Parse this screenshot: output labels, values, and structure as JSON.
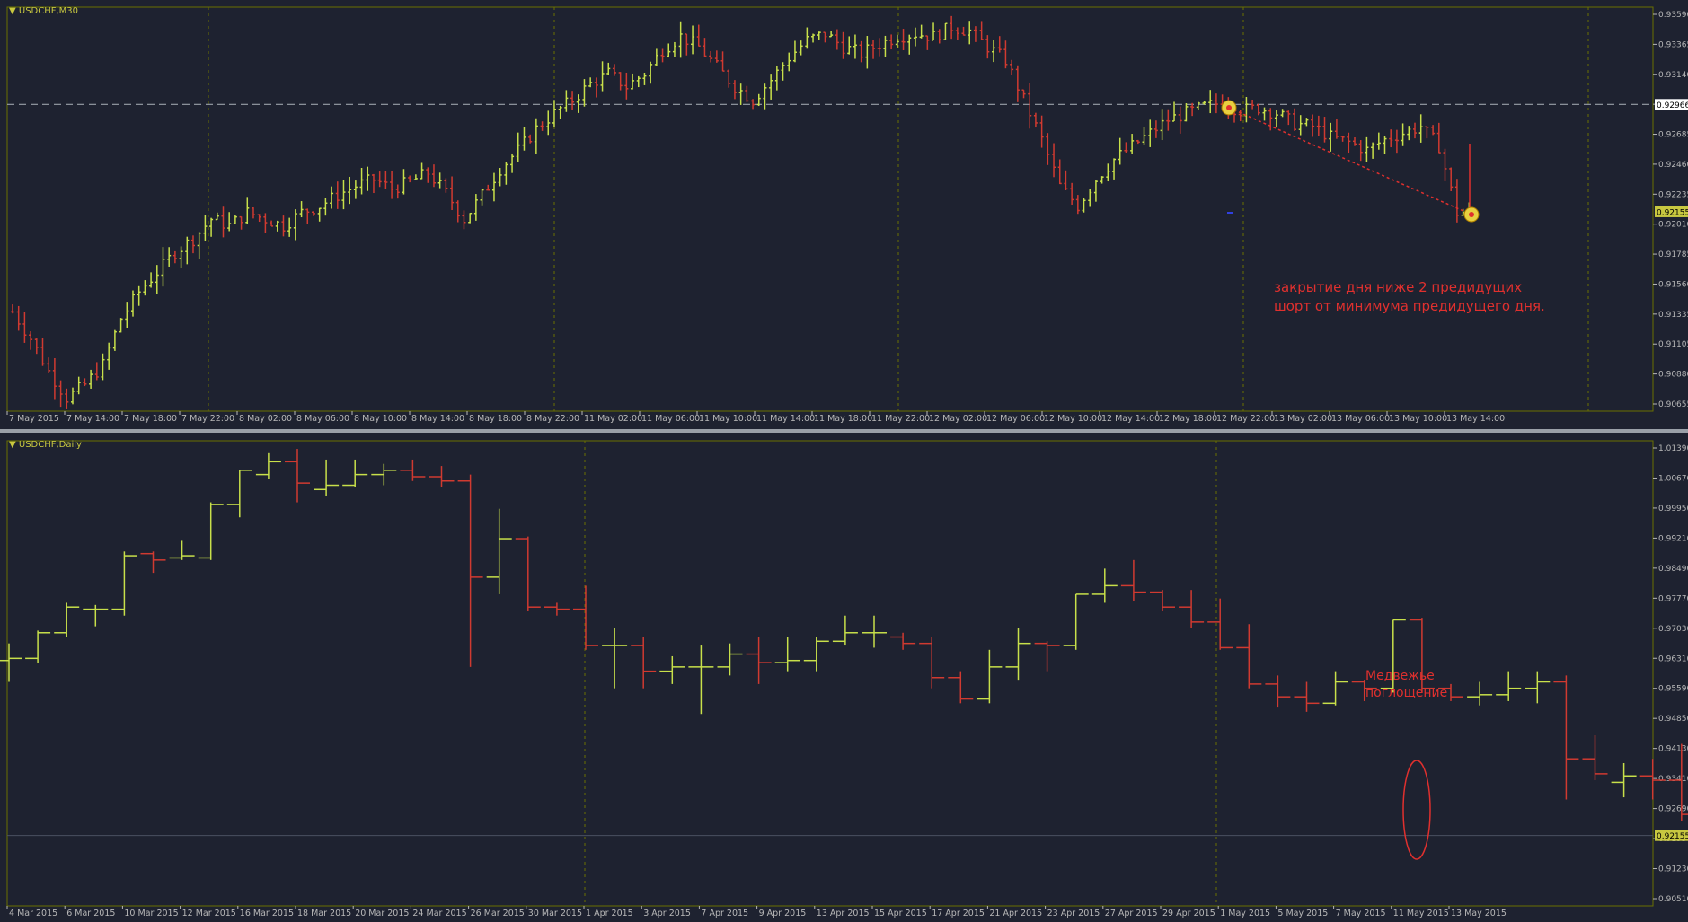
{
  "colors": {
    "bg": "#1e2230",
    "up": "#c8e04a",
    "down": "#d03a30",
    "grid": "#3a4050",
    "frame": "#6a7000",
    "text": "#b8b8b8",
    "dash": "#9aa0a8"
  },
  "chart_data": [
    {
      "type": "bar",
      "title": "USDCHF,M30",
      "ylim": [
        0.9065,
        0.937
      ],
      "y_ticks": [
        "0.93590",
        "0.93365",
        "0.93140",
        "0.92910",
        "0.92685",
        "0.92460",
        "0.92235",
        "0.92010",
        "0.91785",
        "0.91560",
        "0.91335",
        "0.91105",
        "0.90880",
        "0.90655"
      ],
      "x_ticks": [
        "7 May 2015",
        "7 May 14:00",
        "7 May 18:00",
        "7 May 22:00",
        "8 May 02:00",
        "8 May 06:00",
        "8 May 10:00",
        "8 May 14:00",
        "8 May 18:00",
        "8 May 22:00",
        "11 May 02:00",
        "11 May 06:00",
        "11 May 10:00",
        "11 May 14:00",
        "11 May 18:00",
        "11 May 22:00",
        "12 May 02:00",
        "12 May 06:00",
        "12 May 10:00",
        "12 May 14:00",
        "12 May 18:00",
        "12 May 22:00",
        "13 May 02:00",
        "13 May 06:00",
        "13 May 10:00",
        "13 May 14:00"
      ],
      "price_marker": "0.92966",
      "current_price": "0.92155",
      "annotation": "закрытие дня ниже 2 предидущих\nшорт от минимума предидущего дня.",
      "path_close": [
        0.914,
        0.912,
        0.9095,
        0.9075,
        0.9085,
        0.91,
        0.9135,
        0.9155,
        0.917,
        0.9185,
        0.9195,
        0.921,
        0.9205,
        0.9215,
        0.921,
        0.9205,
        0.9215,
        0.922,
        0.9228,
        0.9235,
        0.924,
        0.9233,
        0.9238,
        0.9245,
        0.923,
        0.921,
        0.9228,
        0.9248,
        0.9262,
        0.9278,
        0.929,
        0.93,
        0.9312,
        0.932,
        0.931,
        0.932,
        0.9338,
        0.9348,
        0.934,
        0.9325,
        0.931,
        0.93,
        0.9315,
        0.9332,
        0.9345,
        0.935,
        0.934,
        0.9335,
        0.9342,
        0.9348,
        0.935,
        0.9348,
        0.9355,
        0.9352,
        0.934,
        0.933,
        0.93,
        0.927,
        0.9235,
        0.922,
        0.924,
        0.9255,
        0.9265,
        0.9275,
        0.9285,
        0.929,
        0.9295,
        0.9298,
        0.9292,
        0.9294,
        0.929,
        0.9282,
        0.928,
        0.9272,
        0.9268,
        0.9262,
        0.927,
        0.9275,
        0.928,
        0.9265,
        0.9215
      ]
    },
    {
      "type": "bar",
      "title": "USDCHF,Daily",
      "ylim": [
        0.9051,
        1.0139
      ],
      "y_ticks": [
        "1.01390",
        "1.00670",
        "0.99950",
        "0.99210",
        "0.98490",
        "0.97770",
        "0.97030",
        "0.96310",
        "0.95590",
        "0.94850",
        "0.94130",
        "0.93410",
        "0.92690",
        "0.91950",
        "0.91230",
        "0.90510"
      ],
      "x_ticks": [
        "4 Mar 2015",
        "6 Mar 2015",
        "10 Mar 2015",
        "12 Mar 2015",
        "16 Mar 2015",
        "18 Mar 2015",
        "20 Mar 2015",
        "24 Mar 2015",
        "26 Mar 2015",
        "30 Mar 2015",
        "1 Apr 2015",
        "3 Apr 2015",
        "7 Apr 2015",
        "9 Apr 2015",
        "13 Apr 2015",
        "15 Apr 2015",
        "17 Apr 2015",
        "21 Apr 2015",
        "23 Apr 2015",
        "27 Apr 2015",
        "29 Apr 2015",
        "1 May 2015",
        "5 May 2015",
        "7 May 2015",
        "11 May 2015",
        "13 May 2015"
      ],
      "current_price": "0.92155",
      "annotation": "Медвежье\nпоглощение",
      "bars": [
        {
          "o": 0.9625,
          "h": 0.9665,
          "l": 0.9575,
          "c": 0.963
        },
        {
          "o": 0.963,
          "h": 0.9695,
          "l": 0.962,
          "c": 0.969
        },
        {
          "o": 0.969,
          "h": 0.976,
          "l": 0.968,
          "c": 0.975
        },
        {
          "o": 0.9745,
          "h": 0.9755,
          "l": 0.9705,
          "c": 0.9745
        },
        {
          "o": 0.9745,
          "h": 0.988,
          "l": 0.973,
          "c": 0.987
        },
        {
          "o": 0.9875,
          "h": 0.988,
          "l": 0.983,
          "c": 0.986
        },
        {
          "o": 0.9865,
          "h": 0.9905,
          "l": 0.986,
          "c": 0.987
        },
        {
          "o": 0.9865,
          "h": 0.9995,
          "l": 0.986,
          "c": 0.999
        },
        {
          "o": 0.999,
          "h": 1.007,
          "l": 0.996,
          "c": 1.007
        },
        {
          "o": 1.006,
          "h": 1.011,
          "l": 1.005,
          "c": 1.009
        },
        {
          "o": 1.009,
          "h": 1.012,
          "l": 0.9995,
          "c": 1.004
        },
        {
          "o": 1.0025,
          "h": 1.0095,
          "l": 1.001,
          "c": 1.0035
        },
        {
          "o": 1.0035,
          "h": 1.0095,
          "l": 1.003,
          "c": 1.006
        },
        {
          "o": 1.006,
          "h": 1.0085,
          "l": 1.0035,
          "c": 1.007
        },
        {
          "o": 1.007,
          "h": 1.0095,
          "l": 1.0045,
          "c": 1.0055
        },
        {
          "o": 1.0055,
          "h": 1.008,
          "l": 1.003,
          "c": 1.0045
        },
        {
          "o": 1.0045,
          "h": 1.006,
          "l": 0.961,
          "c": 0.982
        },
        {
          "o": 0.982,
          "h": 0.998,
          "l": 0.978,
          "c": 0.991
        },
        {
          "o": 0.991,
          "h": 0.9915,
          "l": 0.974,
          "c": 0.975
        },
        {
          "o": 0.975,
          "h": 0.976,
          "l": 0.973,
          "c": 0.9745
        },
        {
          "o": 0.9745,
          "h": 0.98,
          "l": 0.965,
          "c": 0.966
        },
        {
          "o": 0.966,
          "h": 0.97,
          "l": 0.956,
          "c": 0.966
        },
        {
          "o": 0.966,
          "h": 0.968,
          "l": 0.956,
          "c": 0.96
        },
        {
          "o": 0.96,
          "h": 0.9635,
          "l": 0.957,
          "c": 0.961
        },
        {
          "o": 0.961,
          "h": 0.966,
          "l": 0.95,
          "c": 0.961
        },
        {
          "o": 0.961,
          "h": 0.9665,
          "l": 0.959,
          "c": 0.964
        },
        {
          "o": 0.964,
          "h": 0.968,
          "l": 0.957,
          "c": 0.962
        },
        {
          "o": 0.962,
          "h": 0.968,
          "l": 0.96,
          "c": 0.9625
        },
        {
          "o": 0.9625,
          "h": 0.968,
          "l": 0.96,
          "c": 0.967
        },
        {
          "o": 0.967,
          "h": 0.973,
          "l": 0.966,
          "c": 0.969
        },
        {
          "o": 0.969,
          "h": 0.973,
          "l": 0.9655,
          "c": 0.969
        },
        {
          "o": 0.968,
          "h": 0.969,
          "l": 0.965,
          "c": 0.9665
        },
        {
          "o": 0.9665,
          "h": 0.968,
          "l": 0.956,
          "c": 0.9585
        },
        {
          "o": 0.9585,
          "h": 0.96,
          "l": 0.9525,
          "c": 0.9535
        },
        {
          "o": 0.9535,
          "h": 0.965,
          "l": 0.9525,
          "c": 0.961
        },
        {
          "o": 0.961,
          "h": 0.97,
          "l": 0.958,
          "c": 0.9665
        },
        {
          "o": 0.9665,
          "h": 0.967,
          "l": 0.96,
          "c": 0.966
        },
        {
          "o": 0.966,
          "h": 0.978,
          "l": 0.965,
          "c": 0.978
        },
        {
          "o": 0.978,
          "h": 0.984,
          "l": 0.976,
          "c": 0.98
        },
        {
          "o": 0.98,
          "h": 0.986,
          "l": 0.9765,
          "c": 0.9785
        },
        {
          "o": 0.9785,
          "h": 0.979,
          "l": 0.974,
          "c": 0.975
        },
        {
          "o": 0.975,
          "h": 0.979,
          "l": 0.97,
          "c": 0.9715
        },
        {
          "o": 0.9715,
          "h": 0.977,
          "l": 0.965,
          "c": 0.9655
        },
        {
          "o": 0.9655,
          "h": 0.971,
          "l": 0.956,
          "c": 0.957
        },
        {
          "o": 0.957,
          "h": 0.959,
          "l": 0.9515,
          "c": 0.954
        },
        {
          "o": 0.954,
          "h": 0.9575,
          "l": 0.9505,
          "c": 0.9525
        },
        {
          "o": 0.9525,
          "h": 0.96,
          "l": 0.952,
          "c": 0.9575
        },
        {
          "o": 0.9575,
          "h": 0.958,
          "l": 0.953,
          "c": 0.956
        },
        {
          "o": 0.956,
          "h": 0.972,
          "l": 0.955,
          "c": 0.972
        },
        {
          "o": 0.972,
          "h": 0.9725,
          "l": 0.955,
          "c": 0.956
        },
        {
          "o": 0.956,
          "h": 0.957,
          "l": 0.953,
          "c": 0.954
        },
        {
          "o": 0.954,
          "h": 0.9575,
          "l": 0.952,
          "c": 0.9545
        },
        {
          "o": 0.9545,
          "h": 0.96,
          "l": 0.953,
          "c": 0.956
        },
        {
          "o": 0.956,
          "h": 0.96,
          "l": 0.9525,
          "c": 0.9575
        },
        {
          "o": 0.9575,
          "h": 0.959,
          "l": 0.93,
          "c": 0.9395
        },
        {
          "o": 0.9395,
          "h": 0.945,
          "l": 0.9345,
          "c": 0.936
        },
        {
          "o": 0.934,
          "h": 0.9385,
          "l": 0.9305,
          "c": 0.9355
        },
        {
          "o": 0.9355,
          "h": 0.9395,
          "l": 0.93,
          "c": 0.9345
        },
        {
          "o": 0.9345,
          "h": 0.943,
          "l": 0.925,
          "c": 0.9265
        },
        {
          "o": 0.9265,
          "h": 0.928,
          "l": 0.91,
          "c": 0.913
        },
        {
          "o": 0.913,
          "h": 0.92,
          "l": 0.9055,
          "c": 0.9185
        },
        {
          "o": 0.9185,
          "h": 0.934,
          "l": 0.917,
          "c": 0.9335
        },
        {
          "o": 0.9335,
          "h": 0.9365,
          "l": 0.931,
          "c": 0.9355
        },
        {
          "o": 0.9355,
          "h": 0.9395,
          "l": 0.924,
          "c": 0.93
        },
        {
          "o": 0.93,
          "h": 0.931,
          "l": 0.921,
          "c": 0.9215
        }
      ]
    }
  ]
}
